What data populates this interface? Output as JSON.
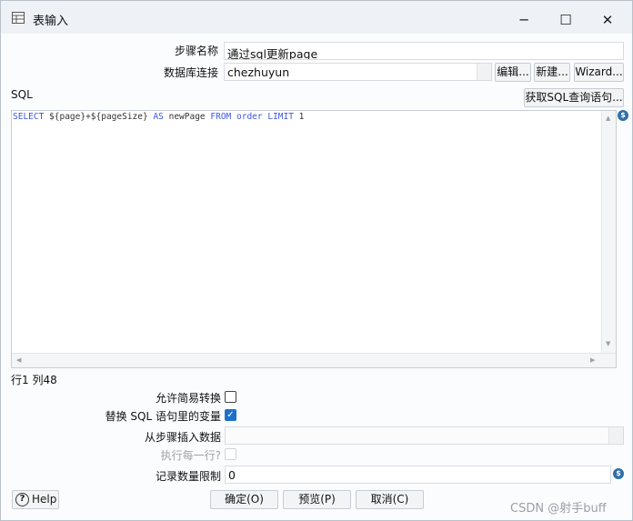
{
  "window": {
    "title": "表输入",
    "icon": "table-input-icon",
    "controls": {
      "minimize": "─",
      "maximize": "☐",
      "close": "✕"
    }
  },
  "form": {
    "step_name_label": "步骤名称",
    "step_name_value": "通过sql更新page",
    "db_conn_label": "数据库连接",
    "db_conn_value": "chezhuyun",
    "edit_button": "编辑...",
    "new_button": "新建...",
    "wizard_button": "Wizard...",
    "sql_label": "SQL",
    "get_sql_button": "获取SQL查询语句..."
  },
  "editor": {
    "tokens": [
      {
        "text": "SELECT",
        "kw": true
      },
      {
        "text": " ${page}+${pageSize} ",
        "kw": false
      },
      {
        "text": "AS",
        "kw": true
      },
      {
        "text": " newPage ",
        "kw": false
      },
      {
        "text": "FROM",
        "kw": true
      },
      {
        "text": " ",
        "kw": false
      },
      {
        "text": "order",
        "kw": true
      },
      {
        "text": " ",
        "kw": false
      },
      {
        "text": "LIMIT",
        "kw": true
      },
      {
        "text": " 1",
        "kw": false
      }
    ]
  },
  "status": {
    "position": "行1 列48"
  },
  "options": {
    "lazy_conversion_label": "允许简易转换",
    "lazy_conversion_checked": false,
    "replace_vars_label": "替换 SQL 语句里的变量",
    "replace_vars_checked": true,
    "insert_from_step_label": "从步骤插入数据",
    "insert_from_step_value": "",
    "execute_each_row_label": "执行每一行?",
    "execute_each_row_checked": false,
    "limit_label": "记录数量限制",
    "limit_value": "0"
  },
  "footer": {
    "help_label": "Help",
    "ok_button": "确定(O)",
    "preview_button": "预览(P)",
    "cancel_button": "取消(C)"
  },
  "watermark": "CSDN @射手buff",
  "colors": {
    "keyword": "#3f56e6",
    "checkbox_checked": "#1d6fc9",
    "variable_badge": "#2f6fa8"
  }
}
